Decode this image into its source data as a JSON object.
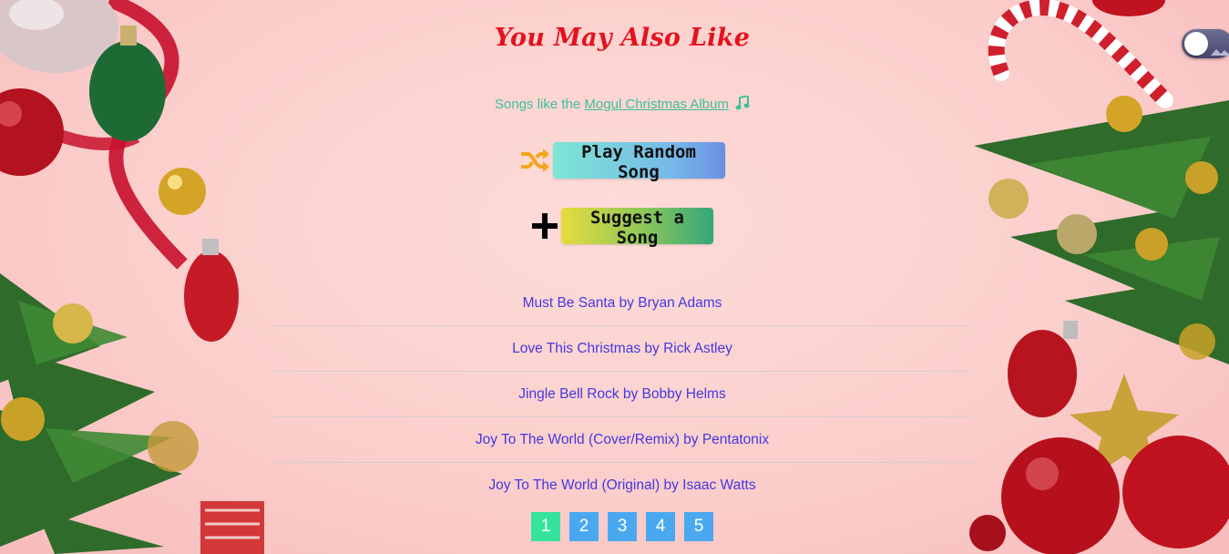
{
  "header": {
    "title": "You May Also Like"
  },
  "subtitle": {
    "prefix": "Songs like the ",
    "album_link": "Mogul Christmas Album",
    "icon": "music-note-icon"
  },
  "actions": {
    "random_label": "Play Random Song",
    "random_icon": "shuffle-icon",
    "suggest_label": "Suggest a Song",
    "suggest_icon": "plus-icon"
  },
  "songs": [
    "Must Be Santa by Bryan Adams",
    "Love This Christmas by Rick Astley",
    "Jingle Bell Rock by Bobby Helms",
    "Joy To The World (Cover/Remix) by Pentatonix",
    "Joy To The World (Original) by Isaac Watts"
  ],
  "pagination": {
    "pages": [
      "1",
      "2",
      "3",
      "4",
      "5"
    ],
    "current": "1"
  },
  "toggle": {
    "state": "off"
  },
  "colors": {
    "title": "#e4121e",
    "subtitle": "#3fbf9c",
    "song_link": "#4637e0",
    "page_button": "#4aa8f0",
    "page_button_active": "#36e39d",
    "shuffle_icon": "#f3a51e"
  }
}
